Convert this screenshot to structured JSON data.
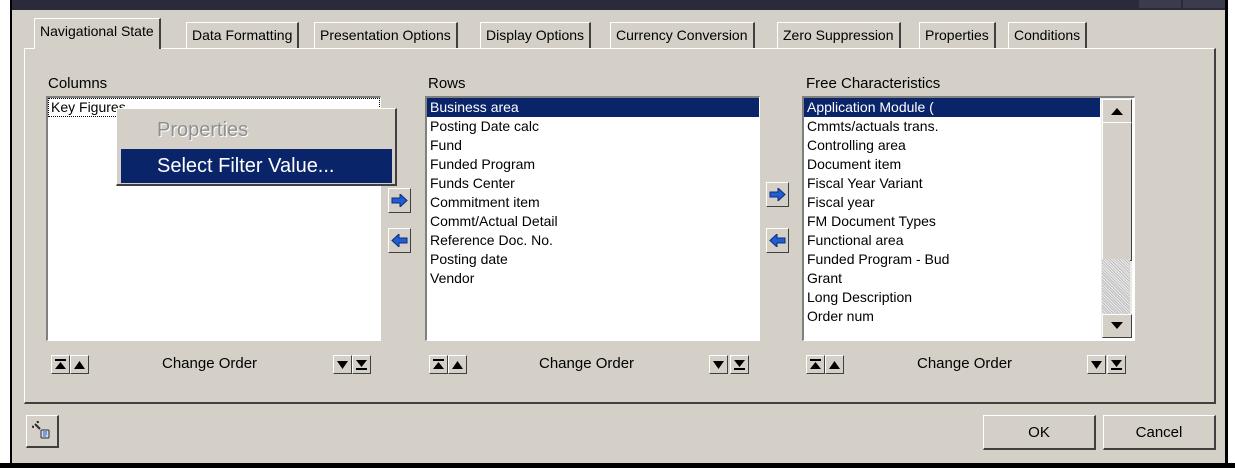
{
  "dialog": {
    "tabs": [
      {
        "label": "Navigational State",
        "active": true
      },
      {
        "label": "Data Formatting"
      },
      {
        "label": "Presentation Options"
      },
      {
        "label": "Display Options"
      },
      {
        "label": "Currency Conversion"
      },
      {
        "label": "Zero Suppression"
      },
      {
        "label": "Properties"
      },
      {
        "label": "Conditions"
      }
    ]
  },
  "columns": {
    "label": "Columns",
    "items": [
      "Key Figures"
    ]
  },
  "rows": {
    "label": "Rows",
    "items": [
      "Business area",
      "Posting Date calc",
      "Fund",
      "Funded Program",
      "Funds Center",
      "Commitment item",
      "Commt/Actual Detail",
      "Reference Doc. No.",
      "Posting date",
      "Vendor"
    ],
    "selected_index": 0
  },
  "free_characteristics": {
    "label": "Free Characteristics",
    "items": [
      "Application Module (",
      "Cmmts/actuals trans.",
      "Controlling area",
      "Document item",
      "Fiscal Year Variant",
      "Fiscal year",
      "FM Document Types",
      "Functional area",
      "Funded Program - Bud",
      "Grant",
      "Long Description",
      "Order num"
    ],
    "selected_index": 0
  },
  "change_order_label": "Change Order",
  "context_menu": {
    "items": [
      {
        "label": "Properties",
        "enabled": false
      },
      {
        "label": "Select Filter Value...",
        "enabled": true,
        "highlighted": true
      }
    ]
  },
  "buttons": {
    "ok": "OK",
    "cancel": "Cancel"
  },
  "icons": {
    "move_right": "blue-arrow-right-icon",
    "move_left": "blue-arrow-left-icon",
    "tools": "wrench-icon"
  },
  "colors": {
    "dialog_bg": "#d4d0c8",
    "selection": "#0a246a",
    "arrow_blue": "#1f5fd1"
  }
}
